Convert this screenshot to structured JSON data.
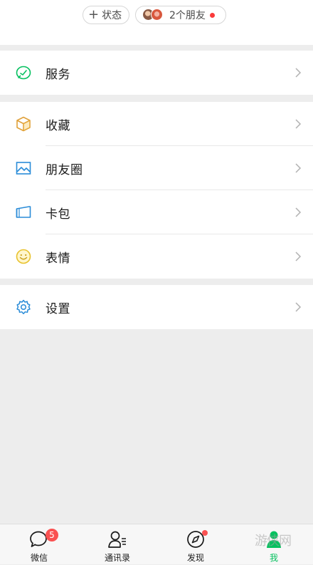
{
  "header": {
    "status_chip": {
      "icon": "plus-icon",
      "label": "状态"
    },
    "friends_chip": {
      "label": "2个朋友",
      "dot_color": "#fa3a3a"
    }
  },
  "menu": {
    "services": {
      "label": "服务",
      "icon": "services-icon"
    },
    "favorites": {
      "label": "收藏",
      "icon": "favorites-cube-icon"
    },
    "moments": {
      "label": "朋友圈",
      "icon": "image-icon"
    },
    "cards": {
      "label": "卡包",
      "icon": "card-wallet-icon"
    },
    "stickers": {
      "label": "表情",
      "icon": "smiley-icon"
    },
    "settings": {
      "label": "设置",
      "icon": "gear-icon"
    }
  },
  "tabbar": {
    "tabs": [
      {
        "label": "微信",
        "icon": "chat-bubble-icon",
        "badge": "5"
      },
      {
        "label": "通讯录",
        "icon": "contacts-icon"
      },
      {
        "label": "发现",
        "icon": "compass-icon"
      },
      {
        "label": "我",
        "icon": "me-icon",
        "active": true
      }
    ]
  },
  "watermark": "游侠网",
  "colors": {
    "accent_green": "#07c160",
    "badge_red": "#fa5151",
    "background": "#ededed"
  }
}
